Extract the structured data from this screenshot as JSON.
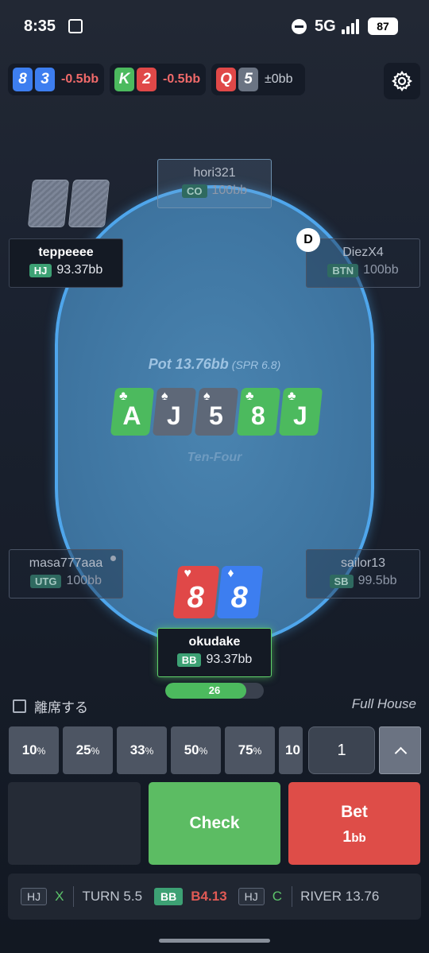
{
  "status": {
    "time": "8:35",
    "network": "5G",
    "battery": "87"
  },
  "hand_history": [
    {
      "cards": [
        {
          "rank": "8",
          "color": "blue"
        },
        {
          "rank": "3",
          "color": "blue"
        }
      ],
      "result": "-0.5bb"
    },
    {
      "cards": [
        {
          "rank": "K",
          "color": "green"
        },
        {
          "rank": "2",
          "color": "red"
        }
      ],
      "result": "-0.5bb"
    },
    {
      "cards": [
        {
          "rank": "Q",
          "color": "red"
        },
        {
          "rank": "5",
          "color": "gray"
        }
      ],
      "result": "±0bb"
    }
  ],
  "table": {
    "pot_label": "Pot 13.76bb",
    "spr": "(SPR 6.8)",
    "board": [
      {
        "rank": "A",
        "suit": "♣",
        "color": "green"
      },
      {
        "rank": "J",
        "suit": "♠",
        "color": "gray"
      },
      {
        "rank": "5",
        "suit": "♠",
        "color": "gray"
      },
      {
        "rank": "8",
        "suit": "♣",
        "color": "green"
      },
      {
        "rank": "J",
        "suit": "♣",
        "color": "green"
      }
    ],
    "hand_nickname": "Ten-Four",
    "dealer_label": "D"
  },
  "seats": {
    "co": {
      "name": "hori321",
      "position": "CO",
      "stack": "100bb"
    },
    "hj": {
      "name": "teppeeee",
      "position": "HJ",
      "stack": "93.37bb"
    },
    "btn": {
      "name": "DiezX4",
      "position": "BTN",
      "stack": "100bb"
    },
    "utg": {
      "name": "masa777aaa",
      "position": "UTG",
      "stack": "100bb"
    },
    "sb": {
      "name": "sailor13",
      "position": "SB",
      "stack": "99.5bb"
    },
    "hero": {
      "name": "okudake",
      "position": "BB",
      "stack": "93.37bb"
    }
  },
  "hero_cards": [
    {
      "rank": "8",
      "suit": "♥",
      "color": "red"
    },
    {
      "rank": "8",
      "suit": "♦",
      "color": "blue"
    }
  ],
  "timer": {
    "value": "26",
    "fraction": 0.82
  },
  "sit_out_label": "離席する",
  "hand_strength": "Full House",
  "bet_presets": [
    {
      "num": "10",
      "unit": "%"
    },
    {
      "num": "25",
      "unit": "%"
    },
    {
      "num": "33",
      "unit": "%"
    },
    {
      "num": "50",
      "unit": "%"
    },
    {
      "num": "75",
      "unit": "%"
    },
    {
      "num": "10",
      "unit": ""
    }
  ],
  "bet_amount": "1",
  "actions": {
    "check_label": "Check",
    "bet_label": "Bet",
    "bet_amount": "1",
    "bet_unit": "bb"
  },
  "action_log": {
    "p1": "HJ",
    "a1": "X",
    "turn": "TURN 5.5",
    "p2": "BB",
    "a2": "B4.13",
    "p3": "HJ",
    "a3": "C",
    "river": "RIVER 13.76"
  }
}
